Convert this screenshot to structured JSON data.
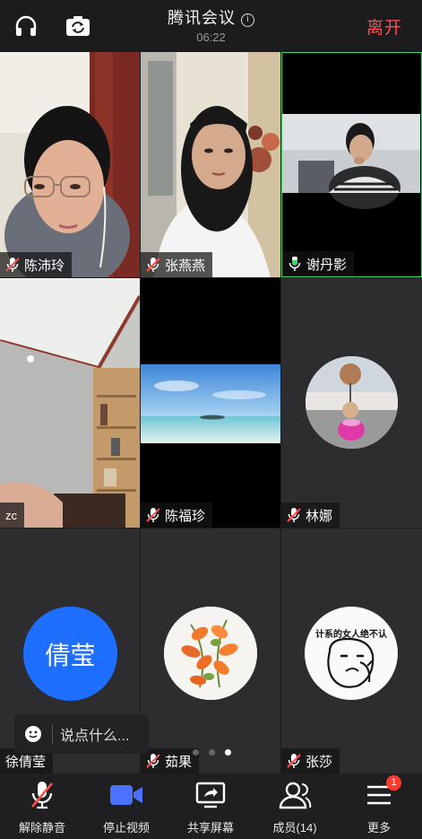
{
  "header": {
    "title": "腾讯会议",
    "info_glyph": "i",
    "timer": "06:22",
    "leave_label": "离开"
  },
  "participants": [
    {
      "name": "陈沛玲",
      "mic": "muted"
    },
    {
      "name": "张燕燕",
      "mic": "muted"
    },
    {
      "name": "谢丹影",
      "mic": "speaking"
    },
    {
      "name": "zc",
      "mic": "none"
    },
    {
      "name": "陈福珍",
      "mic": "muted"
    },
    {
      "name": "林娜",
      "mic": "muted"
    },
    {
      "name": "徐倩莹",
      "mic": "none",
      "avatar_text": "倩莹"
    },
    {
      "name": "茹果",
      "mic": "muted"
    },
    {
      "name": "张莎",
      "mic": "muted"
    }
  ],
  "sticker_text": "计系的女人绝不认",
  "chat": {
    "placeholder": "说点什么..."
  },
  "pagination": {
    "pages": 3,
    "current": 3
  },
  "toolbar": {
    "unmute": "解除静音",
    "stop_video": "停止视频",
    "share_screen": "共享屏幕",
    "members": "成员(14)",
    "more": "更多",
    "more_badge": "1"
  },
  "colors": {
    "accent_blue": "#1e6fff",
    "leave_red": "#ff4d4f",
    "speaking_green": "#3ed36b",
    "muted_red": "#ff4d4f",
    "video_icon_blue": "#4a72ff"
  }
}
